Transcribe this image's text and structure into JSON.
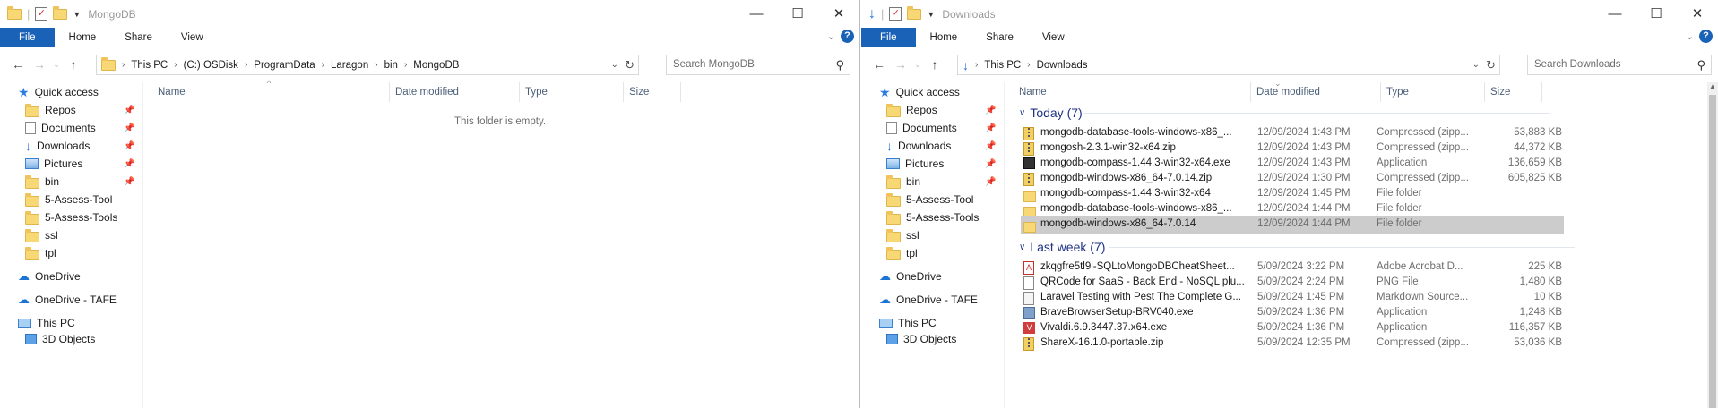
{
  "left": {
    "title": "MongoDB",
    "tabs": {
      "file": "File",
      "home": "Home",
      "share": "Share",
      "view": "View"
    },
    "address": [
      "This PC",
      "(C:) OSDisk",
      "ProgramData",
      "Laragon",
      "bin",
      "MongoDB"
    ],
    "search_placeholder": "Search MongoDB",
    "columns": {
      "name": "Name",
      "date": "Date modified",
      "type": "Type",
      "size": "Size"
    },
    "empty_message": "This folder is empty.",
    "nav": [
      {
        "label": "Quick access",
        "icon": "star-icon"
      },
      {
        "label": "Repos",
        "icon": "folder-icon",
        "pinned": true
      },
      {
        "label": "Documents",
        "icon": "document-icon",
        "pinned": true
      },
      {
        "label": "Downloads",
        "icon": "download-icon",
        "pinned": true
      },
      {
        "label": "Pictures",
        "icon": "pictures-icon",
        "pinned": true
      },
      {
        "label": "bin",
        "icon": "folder-icon",
        "pinned": true
      },
      {
        "label": "5-Assess-Tool",
        "icon": "folder-icon"
      },
      {
        "label": "5-Assess-Tools",
        "icon": "folder-icon"
      },
      {
        "label": "ssl",
        "icon": "folder-icon"
      },
      {
        "label": "tpl",
        "icon": "folder-icon"
      },
      {
        "label": "OneDrive",
        "icon": "cloud-icon"
      },
      {
        "label": "OneDrive - TAFE",
        "icon": "cloud-icon"
      },
      {
        "label": "This PC",
        "icon": "computer-icon"
      },
      {
        "label": "3D Objects",
        "icon": "cube-icon"
      }
    ]
  },
  "right": {
    "title": "Downloads",
    "tabs": {
      "file": "File",
      "home": "Home",
      "share": "Share",
      "view": "View"
    },
    "address": [
      "This PC",
      "Downloads"
    ],
    "search_placeholder": "Search Downloads",
    "columns": {
      "name": "Name",
      "date": "Date modified",
      "type": "Type",
      "size": "Size"
    },
    "nav": [
      {
        "label": "Quick access",
        "icon": "star-icon"
      },
      {
        "label": "Repos",
        "icon": "folder-icon",
        "pinned": true
      },
      {
        "label": "Documents",
        "icon": "document-icon",
        "pinned": true
      },
      {
        "label": "Downloads",
        "icon": "download-icon",
        "pinned": true
      },
      {
        "label": "Pictures",
        "icon": "pictures-icon",
        "pinned": true
      },
      {
        "label": "bin",
        "icon": "folder-icon",
        "pinned": true
      },
      {
        "label": "5-Assess-Tool",
        "icon": "folder-icon"
      },
      {
        "label": "5-Assess-Tools",
        "icon": "folder-icon"
      },
      {
        "label": "ssl",
        "icon": "folder-icon"
      },
      {
        "label": "tpl",
        "icon": "folder-icon"
      },
      {
        "label": "OneDrive",
        "icon": "cloud-icon"
      },
      {
        "label": "OneDrive - TAFE",
        "icon": "cloud-icon"
      },
      {
        "label": "This PC",
        "icon": "computer-icon"
      },
      {
        "label": "3D Objects",
        "icon": "cube-icon"
      }
    ],
    "groups": [
      {
        "label": "Today (7)",
        "files": [
          {
            "name": "mongodb-database-tools-windows-x86_...",
            "date": "12/09/2024 1:43 PM",
            "type": "Compressed (zipp...",
            "size": "53,883 KB",
            "icon": "zip-icon"
          },
          {
            "name": "mongosh-2.3.1-win32-x64.zip",
            "date": "12/09/2024 1:43 PM",
            "type": "Compressed (zipp...",
            "size": "44,372 KB",
            "icon": "zip-icon"
          },
          {
            "name": "mongodb-compass-1.44.3-win32-x64.exe",
            "date": "12/09/2024 1:43 PM",
            "type": "Application",
            "size": "136,659 KB",
            "icon": "exe-icon"
          },
          {
            "name": "mongodb-windows-x86_64-7.0.14.zip",
            "date": "12/09/2024 1:30 PM",
            "type": "Compressed (zipp...",
            "size": "605,825 KB",
            "icon": "zip-icon"
          },
          {
            "name": "mongodb-compass-1.44.3-win32-x64",
            "date": "12/09/2024 1:45 PM",
            "type": "File folder",
            "size": "",
            "icon": "folder-icon"
          },
          {
            "name": "mongodb-database-tools-windows-x86_...",
            "date": "12/09/2024 1:44 PM",
            "type": "File folder",
            "size": "",
            "icon": "folder-icon"
          },
          {
            "name": "mongodb-windows-x86_64-7.0.14",
            "date": "12/09/2024 1:44 PM",
            "type": "File folder",
            "size": "",
            "icon": "folder-icon",
            "selected": true
          }
        ]
      },
      {
        "label": "Last week (7)",
        "files": [
          {
            "name": "zkqgfre5tl9l-SQLtoMongoDBCheatSheet...",
            "date": "5/09/2024 3:22 PM",
            "type": "Adobe Acrobat D...",
            "size": "225 KB",
            "icon": "pdf-icon"
          },
          {
            "name": "QRCode for SaaS - Back End - NoSQL plu...",
            "date": "5/09/2024 2:24 PM",
            "type": "PNG File",
            "size": "1,480 KB",
            "icon": "png-icon"
          },
          {
            "name": "Laravel Testing with Pest The Complete G...",
            "date": "5/09/2024 1:45 PM",
            "type": "Markdown Source...",
            "size": "10 KB",
            "icon": "markdown-icon"
          },
          {
            "name": "BraveBrowserSetup-BRV040.exe",
            "date": "5/09/2024 1:36 PM",
            "type": "Application",
            "size": "1,248 KB",
            "icon": "brave-icon"
          },
          {
            "name": "Vivaldi.6.9.3447.37.x64.exe",
            "date": "5/09/2024 1:36 PM",
            "type": "Application",
            "size": "116,357 KB",
            "icon": "vivaldi-icon"
          },
          {
            "name": "ShareX-16.1.0-portable.zip",
            "date": "5/09/2024 12:35 PM",
            "type": "Compressed (zipp...",
            "size": "53,036 KB",
            "icon": "zip-icon"
          }
        ]
      }
    ]
  },
  "colors": {
    "accent": "#1a62b8",
    "group_header": "#1e3287",
    "selected_row": "#cccccc"
  }
}
